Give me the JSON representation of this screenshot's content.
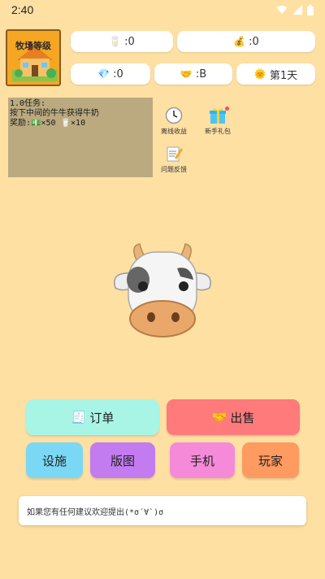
{
  "status_bar": {
    "time": "2:40",
    "icons": [
      "wifi-icon",
      "signal-icon",
      "battery-icon"
    ]
  },
  "farm_level": {
    "label": "牧场等级"
  },
  "resources": {
    "milk": {
      "icon": "milk-icon",
      "value": ":0"
    },
    "money": {
      "icon": "money-bag-icon",
      "value": ":0"
    },
    "diamond": {
      "icon": "diamond-icon",
      "value": ":0"
    },
    "reputation": {
      "icon": "handshake-icon",
      "value": ":B"
    },
    "day": {
      "icon": "sun-icon",
      "value": "第1天"
    }
  },
  "task": {
    "title": "1.0任务:",
    "desc": "按下中间的牛牛获得牛奶",
    "reward_label": "奖励:",
    "reward_cash": "×50",
    "reward_milk": "×10"
  },
  "side_buttons": {
    "offline": "离线收益",
    "gift": "新手礼包",
    "feedback": "问题反馈"
  },
  "actions": {
    "orders": "订单",
    "sell": "出售",
    "facilities": "设施",
    "territory": "版图",
    "phone": "手机",
    "players": "玩家"
  },
  "message": "如果您有任何建议欢迎提出(*σ´∀`)σ",
  "colors": {
    "background": "#FFE0A3",
    "orders": "#A8F5E6",
    "sell": "#FF7A7A",
    "facilities": "#7BD8F5",
    "territory": "#C37BF0",
    "phone": "#F58BD8",
    "players": "#FF9A60"
  }
}
